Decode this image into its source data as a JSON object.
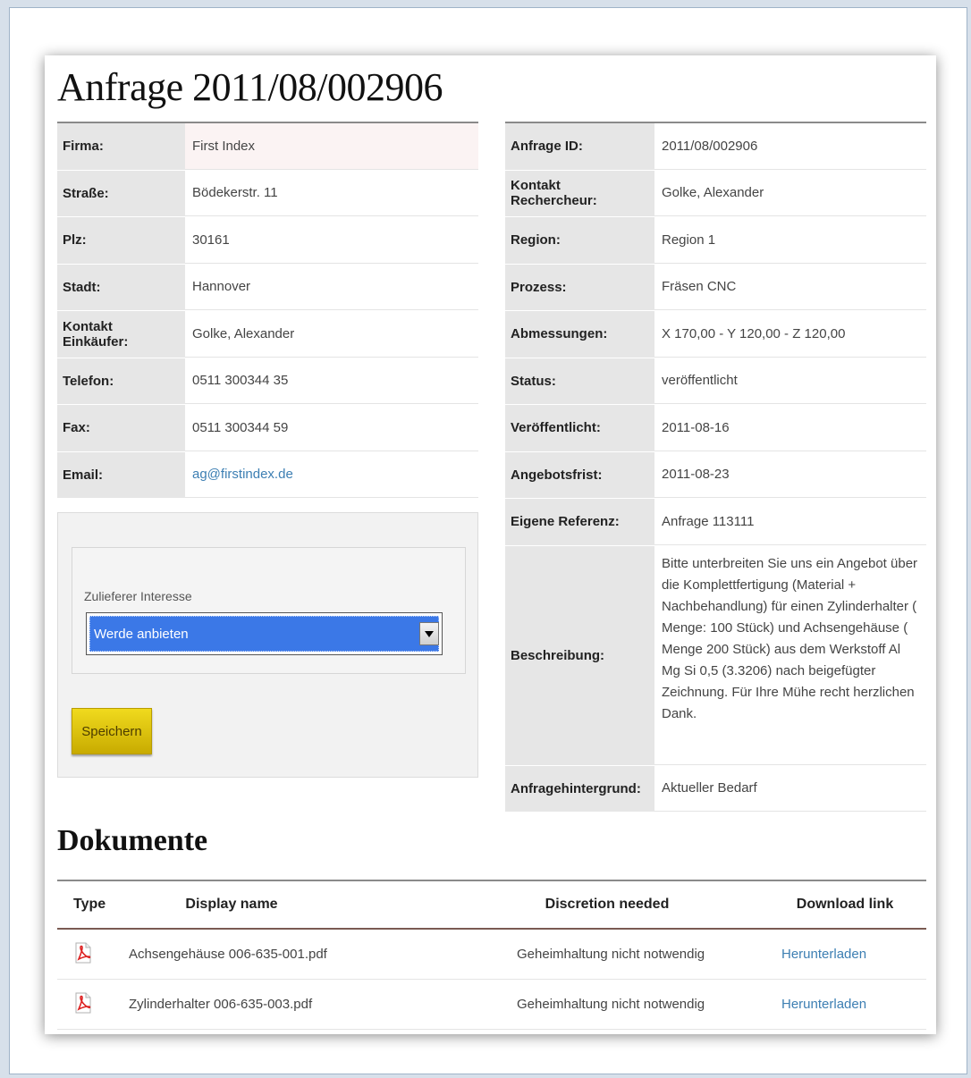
{
  "page": {
    "title": "Anfrage 2011/08/002906"
  },
  "left_table": [
    {
      "label": "Firma:",
      "value": "First Index"
    },
    {
      "label": "Straße:",
      "value": "Bödekerstr. 11"
    },
    {
      "label": "Plz:",
      "value": "30161"
    },
    {
      "label": "Stadt:",
      "value": "Hannover"
    },
    {
      "label": "Kontakt Einkäufer:",
      "value": "Golke, Alexander"
    },
    {
      "label": "Telefon:",
      "value": "0511 300344 35"
    },
    {
      "label": "Fax:",
      "value": "0511 300344 59"
    },
    {
      "label": "Email:",
      "value": "ag@firstindex.de"
    }
  ],
  "right_table": [
    {
      "label": "Anfrage ID:",
      "value": "2011/08/002906"
    },
    {
      "label": "Kontakt Rechercheur:",
      "value": "Golke, Alexander"
    },
    {
      "label": "Region:",
      "value": "Region 1"
    },
    {
      "label": "Prozess:",
      "value": "Fräsen CNC"
    },
    {
      "label": "Abmessungen:",
      "value": "X 170,00 - Y 120,00 - Z 120,00"
    },
    {
      "label": "Status:",
      "value": "veröffentlicht"
    },
    {
      "label": "Veröffentlicht:",
      "value": "2011-08-16"
    },
    {
      "label": "Angebotsfrist:",
      "value": "2011-08-23"
    },
    {
      "label": "Eigene Referenz:",
      "value": "Anfrage 113111"
    },
    {
      "label": "Beschreibung:",
      "value": "Bitte unterbreiten Sie uns ein Angebot über die Komplettfertigung (Material + Nachbehandlung) für einen Zylinderhalter ( Menge: 100 Stück) und Achsengehäuse ( Menge 200 Stück) aus dem Werkstoff Al Mg Si 0,5 (3.3206) nach beigefügter Zeichnung. Für Ihre Mühe recht herzlichen Dank."
    },
    {
      "label": "Anfragehintergrund:",
      "value": "Aktueller Bedarf"
    }
  ],
  "form": {
    "field_label": "Zulieferer Interesse",
    "selected_option": "Werde anbieten",
    "save_label": "Speichern"
  },
  "documents": {
    "title": "Dokumente",
    "columns": [
      "Type",
      "Display name",
      "Discretion needed",
      "Download link"
    ],
    "rows": [
      {
        "type_icon": "pdf-icon",
        "name": "Achsengehäuse 006-635-001.pdf",
        "discretion": "Geheimhaltung nicht notwendig",
        "link": "Herunterladen"
      },
      {
        "type_icon": "pdf-icon",
        "name": "Zylinderhalter 006-635-003.pdf",
        "discretion": "Geheimhaltung nicht notwendig",
        "link": "Herunterladen"
      }
    ]
  },
  "colors": {
    "save_button": "#e0c40c",
    "select_highlight": "#3b78e7",
    "link": "#3d7fb3"
  }
}
